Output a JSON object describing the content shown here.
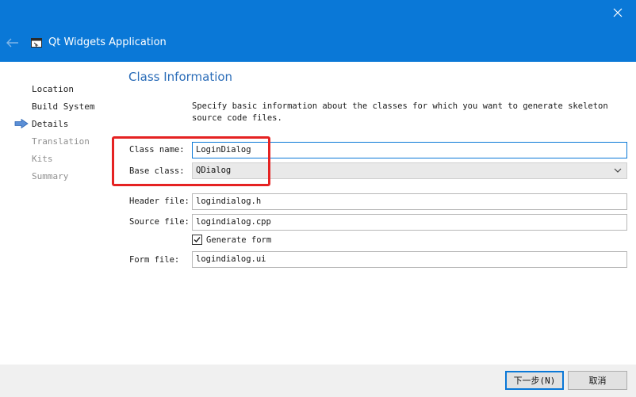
{
  "window": {
    "title": "Qt Widgets Application",
    "icons": {
      "close": "close-icon",
      "back": "back-arrow-icon",
      "app": "qt-app-icon"
    },
    "titlebar_color": "#0a78d7"
  },
  "nav": {
    "current_index": 2,
    "steps": [
      {
        "label": "Location",
        "enabled": true
      },
      {
        "label": "Build System",
        "enabled": true
      },
      {
        "label": "Details",
        "enabled": true,
        "current": true
      },
      {
        "label": "Translation",
        "enabled": false
      },
      {
        "label": "Kits",
        "enabled": false
      },
      {
        "label": "Summary",
        "enabled": false
      }
    ]
  },
  "page": {
    "title": "Class Information",
    "intro": "Specify basic information about the classes for which you want to generate skeleton source code files."
  },
  "form": {
    "class_name": {
      "label": "Class name:",
      "value": "LoginDialog"
    },
    "base_class": {
      "label": "Base class:",
      "value": "QDialog"
    },
    "header_file": {
      "label": "Header file:",
      "value": "logindialog.h"
    },
    "source_file": {
      "label": "Source file:",
      "value": "logindialog.cpp"
    },
    "generate_form": {
      "label": "Generate form",
      "checked": true
    },
    "form_file": {
      "label": "Form file:",
      "value": "logindialog.ui"
    }
  },
  "buttons": {
    "next": "下一步(N)",
    "cancel": "取消"
  },
  "annotation": {
    "color": "#e52222"
  }
}
